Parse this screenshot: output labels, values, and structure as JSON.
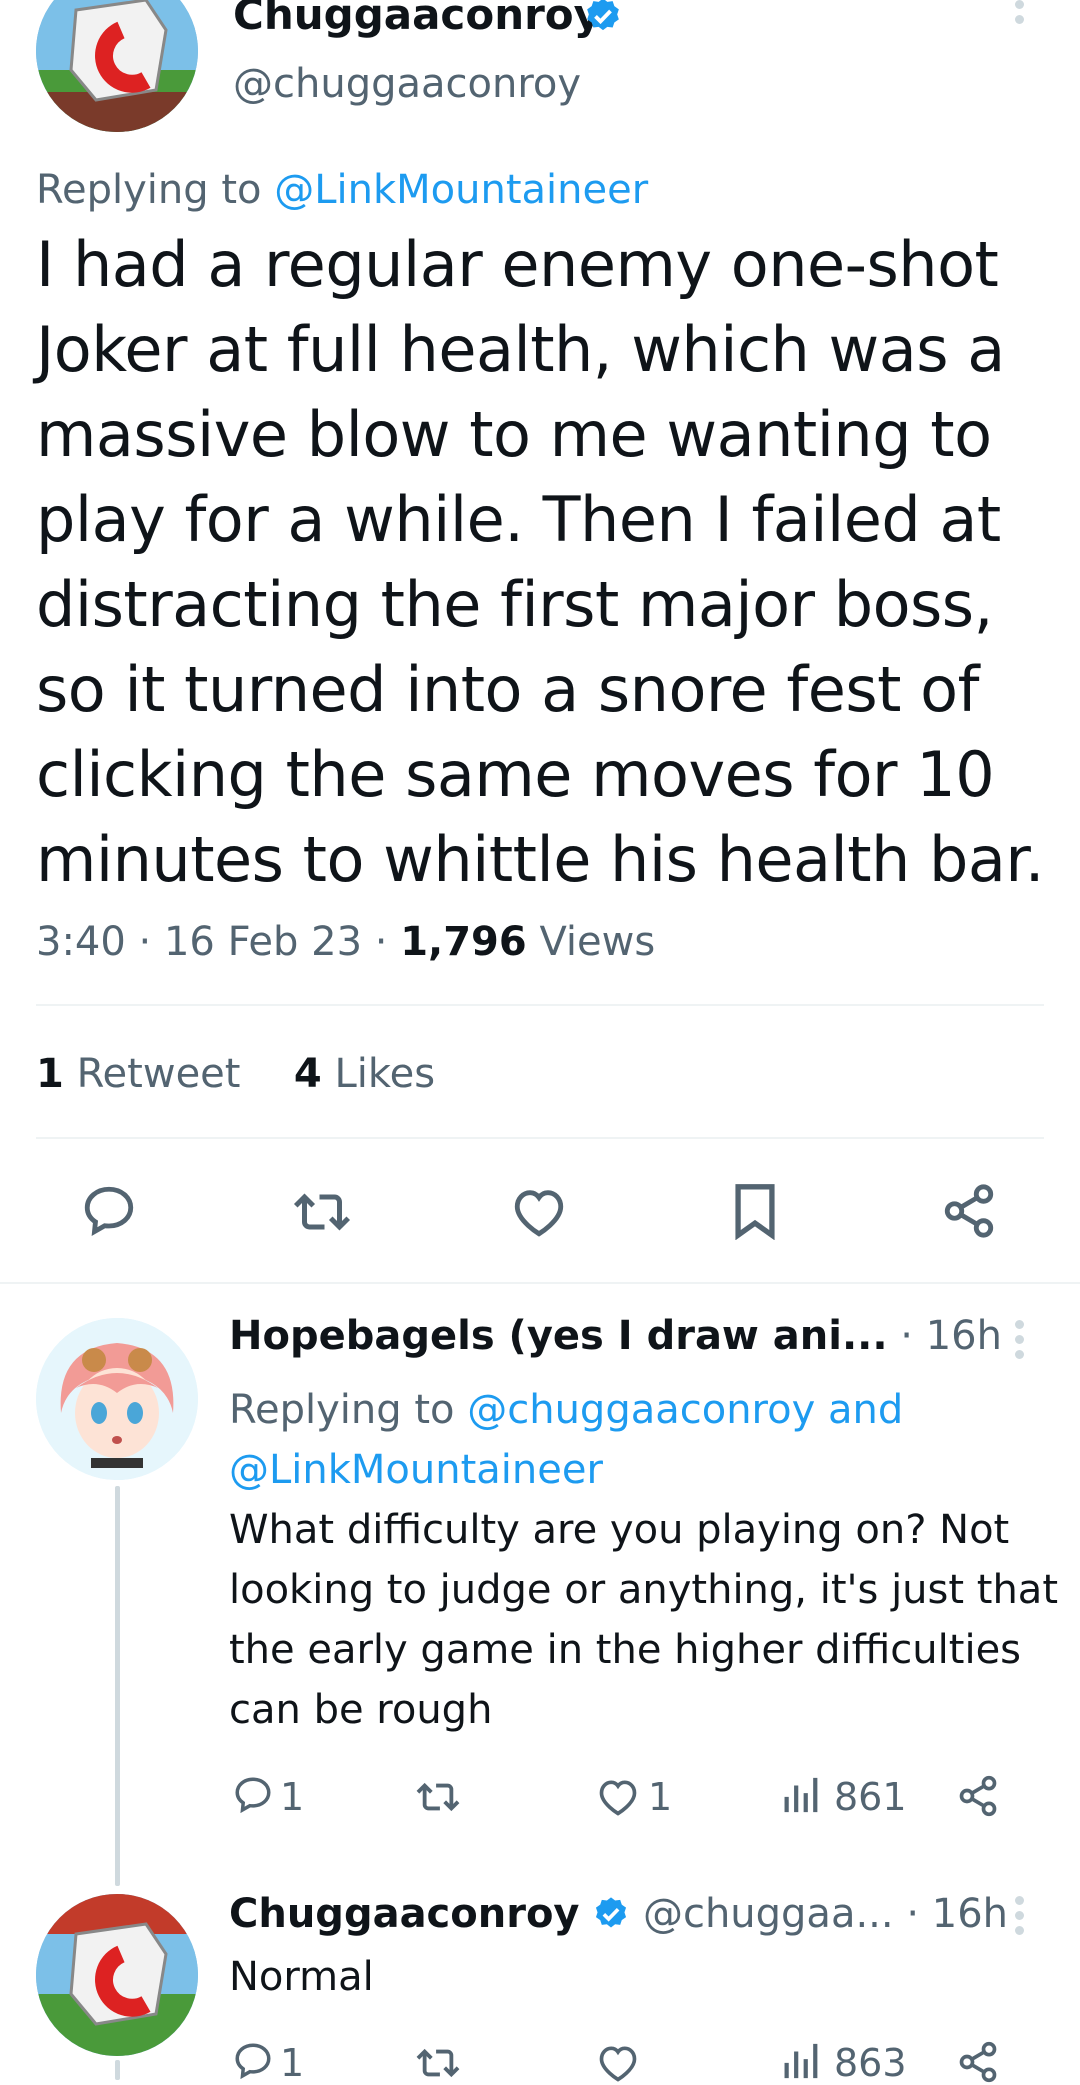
{
  "main_tweet": {
    "display_name": "Chuggaaconroy",
    "handle": "@chuggaaconroy",
    "replying_prefix": "Replying to",
    "replying_to": "@LinkMountaineer",
    "text_lines": [
      "I had a regular enemy one-shot",
      "Joker at full health, which was a",
      "massive blow to me wanting to",
      "play for a while. Then I failed at",
      "distracting the first major boss,",
      "so it turned into a snore fest of",
      "clicking the same moves for 10",
      "minutes to whittle his health bar."
    ],
    "time": "3:40",
    "date": "16 Feb 23",
    "views_count": "1,796",
    "views_label": "Views",
    "retweet_count": "1",
    "retweet_label": "Retweet",
    "likes_count": "4",
    "likes_label": "Likes"
  },
  "reply_1": {
    "display_name": "Hopebagels (yes I draw ani...",
    "time": "· 16h",
    "replying_prefix": "Replying to",
    "replying_to_line1": "@chuggaaconroy and",
    "replying_to_line2": "@LinkMountaineer",
    "text_lines": [
      "What difficulty are you playing on? Not",
      "looking to judge or anything, it's just that",
      "the early game in the higher difficulties",
      "can be rough"
    ],
    "reply_count": "1",
    "like_count": "1",
    "view_count": "861"
  },
  "reply_2": {
    "display_name": "Chuggaaconroy",
    "handle": "@chuggaa...",
    "time": "· 16h",
    "text": "Normal",
    "reply_count": "1",
    "view_count": "863"
  },
  "colors": {
    "accent": "#1d9bf0",
    "muted": "#536471",
    "text": "#0f1419",
    "verified": "#1d9bf0"
  }
}
